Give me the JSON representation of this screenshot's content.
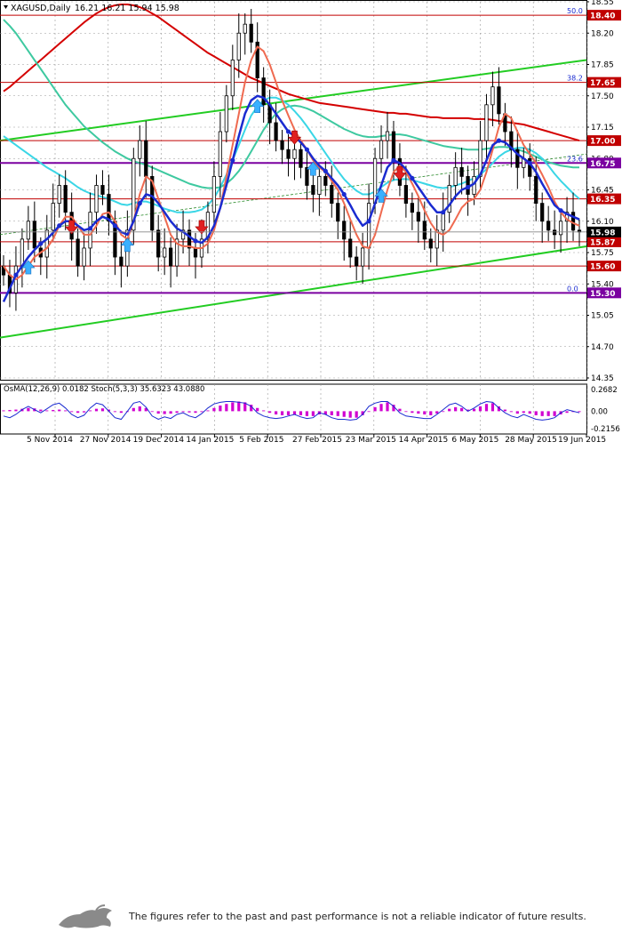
{
  "chart_data": {
    "type": "candlestick",
    "title": "XAGUSD,Daily",
    "ohlc_text": "16.21 16.21 15.94 15.98",
    "ylim": [
      14.35,
      18.55
    ],
    "price_ticks": [
      "18.55",
      "18.20",
      "17.85",
      "17.50",
      "17.15",
      "16.80",
      "16.45",
      "16.10",
      "15.75",
      "15.40",
      "15.05",
      "14.70",
      "14.35"
    ],
    "x_labels": [
      "5 Nov 2014",
      "27 Nov 2014",
      "19 Dec 2014",
      "14 Jan 2015",
      "5 Feb 2015",
      "27 Feb 2015",
      "23 Mar 2015",
      "14 Apr 2015",
      "6 May 2015",
      "28 May 2015",
      "19 Jun 2015"
    ],
    "levels": [
      {
        "value": 18.4,
        "label": "18.40",
        "color": "#c00000",
        "fib": "50.0"
      },
      {
        "value": 17.65,
        "label": "17.65",
        "color": "#c00000",
        "fib": "38.2"
      },
      {
        "value": 17.0,
        "label": "17.00",
        "color": "#c00000",
        "fib": ""
      },
      {
        "value": 16.75,
        "label": "16.75",
        "color": "#7a00a0",
        "fib": "23.6"
      },
      {
        "value": 16.35,
        "label": "16.35",
        "color": "#c00000",
        "fib": ""
      },
      {
        "value": 15.87,
        "label": "15.87",
        "color": "#c00000",
        "fib": ""
      },
      {
        "value": 15.6,
        "label": "15.60",
        "color": "#c00000",
        "fib": ""
      },
      {
        "value": 15.3,
        "label": "15.30",
        "color": "#7a00a0",
        "fib": "0.0"
      }
    ],
    "current": {
      "value": 15.98,
      "label": "15.98"
    },
    "closes": [
      15.5,
      15.3,
      15.6,
      15.9,
      16.1,
      15.8,
      15.7,
      16.0,
      16.3,
      16.5,
      16.2,
      15.9,
      15.6,
      15.8,
      16.2,
      16.5,
      16.4,
      16.1,
      15.7,
      15.6,
      16.0,
      16.8,
      17.0,
      16.6,
      16.0,
      15.7,
      15.8,
      15.6,
      15.9,
      16.0,
      15.8,
      15.7,
      15.9,
      16.2,
      16.6,
      17.1,
      17.5,
      17.9,
      18.2,
      18.3,
      18.1,
      17.7,
      17.4,
      17.2,
      17.0,
      16.9,
      16.8,
      16.9,
      16.7,
      16.5,
      16.4,
      16.6,
      16.5,
      16.3,
      16.1,
      15.9,
      15.7,
      15.6,
      15.8,
      16.3,
      16.8,
      17.0,
      17.1,
      16.8,
      16.5,
      16.3,
      16.2,
      16.1,
      15.9,
      15.8,
      16.0,
      16.2,
      16.5,
      16.7,
      16.6,
      16.4,
      16.6,
      17.0,
      17.4,
      17.6,
      17.3,
      17.1,
      16.9,
      16.7,
      16.8,
      16.6,
      16.3,
      16.1,
      16.0,
      15.95,
      16.1,
      16.2,
      16.0,
      15.98
    ],
    "ema_blue": [
      15.2,
      15.35,
      15.5,
      15.6,
      15.7,
      15.78,
      15.85,
      15.9,
      15.97,
      16.05,
      16.1,
      16.1,
      16.05,
      16.0,
      16.02,
      16.1,
      16.15,
      16.12,
      16.05,
      15.98,
      15.95,
      16.1,
      16.3,
      16.4,
      16.38,
      16.3,
      16.2,
      16.1,
      16.02,
      15.98,
      15.93,
      15.88,
      15.86,
      15.92,
      16.05,
      16.25,
      16.5,
      16.78,
      17.05,
      17.3,
      17.45,
      17.5,
      17.48,
      17.4,
      17.3,
      17.2,
      17.1,
      17.05,
      16.98,
      16.9,
      16.8,
      16.72,
      16.66,
      16.58,
      16.5,
      16.4,
      16.28,
      16.15,
      16.05,
      16.1,
      16.3,
      16.5,
      16.7,
      16.78,
      16.75,
      16.68,
      16.58,
      16.48,
      16.38,
      16.28,
      16.2,
      16.2,
      16.28,
      16.38,
      16.45,
      16.48,
      16.52,
      16.62,
      16.78,
      16.95,
      17.0,
      16.98,
      16.92,
      16.85,
      16.8,
      16.75,
      16.65,
      16.52,
      16.4,
      16.28,
      16.22,
      16.18,
      16.15,
      16.12
    ],
    "ma_cyan": [
      17.05,
      17.0,
      16.95,
      16.9,
      16.85,
      16.8,
      16.75,
      16.7,
      16.66,
      16.62,
      16.58,
      16.53,
      16.48,
      16.44,
      16.41,
      16.39,
      16.37,
      16.35,
      16.32,
      16.29,
      16.28,
      16.3,
      16.32,
      16.32,
      16.3,
      16.27,
      16.24,
      16.22,
      16.2,
      16.2,
      16.2,
      16.21,
      16.23,
      16.28,
      16.36,
      16.48,
      16.62,
      16.78,
      16.95,
      17.12,
      17.28,
      17.38,
      17.45,
      17.48,
      17.48,
      17.45,
      17.4,
      17.33,
      17.25,
      17.16,
      17.06,
      16.96,
      16.86,
      16.76,
      16.66,
      16.57,
      16.5,
      16.44,
      16.4,
      16.4,
      16.43,
      16.48,
      16.53,
      16.56,
      16.57,
      16.57,
      16.56,
      16.54,
      16.52,
      16.5,
      16.48,
      16.47,
      16.48,
      16.5,
      16.52,
      16.55,
      16.58,
      16.62,
      16.68,
      16.75,
      16.82,
      16.87,
      16.9,
      16.92,
      16.92,
      16.9,
      16.86,
      16.8,
      16.72,
      16.63,
      16.55,
      16.48,
      16.41,
      16.35
    ],
    "ma_teal": [
      18.35,
      18.28,
      18.2,
      18.1,
      18.0,
      17.9,
      17.8,
      17.7,
      17.6,
      17.5,
      17.4,
      17.32,
      17.24,
      17.16,
      17.1,
      17.04,
      16.98,
      16.93,
      16.88,
      16.84,
      16.8,
      16.77,
      16.75,
      16.73,
      16.7,
      16.67,
      16.64,
      16.61,
      16.58,
      16.55,
      16.52,
      16.5,
      16.48,
      16.47,
      16.47,
      16.48,
      16.52,
      16.58,
      16.66,
      16.76,
      16.88,
      17.0,
      17.12,
      17.22,
      17.3,
      17.35,
      17.38,
      17.39,
      17.38,
      17.36,
      17.33,
      17.29,
      17.25,
      17.21,
      17.17,
      17.13,
      17.1,
      17.07,
      17.05,
      17.04,
      17.04,
      17.05,
      17.06,
      17.07,
      17.07,
      17.06,
      17.04,
      17.02,
      17.0,
      16.98,
      16.96,
      16.94,
      16.93,
      16.92,
      16.91,
      16.9,
      16.9,
      16.9,
      16.91,
      16.92,
      16.93,
      16.93,
      16.92,
      16.9,
      16.88,
      16.85,
      16.82,
      16.79,
      16.76,
      16.74,
      16.72,
      16.71,
      16.7,
      16.7
    ],
    "ma_red": [
      17.55,
      17.6,
      17.66,
      17.72,
      17.78,
      17.84,
      17.9,
      17.96,
      18.02,
      18.08,
      18.14,
      18.2,
      18.26,
      18.32,
      18.37,
      18.42,
      18.46,
      18.49,
      18.51,
      18.52,
      18.52,
      18.51,
      18.49,
      18.46,
      18.42,
      18.38,
      18.33,
      18.28,
      18.23,
      18.18,
      18.13,
      18.08,
      18.03,
      17.98,
      17.94,
      17.9,
      17.86,
      17.82,
      17.78,
      17.74,
      17.7,
      17.67,
      17.64,
      17.61,
      17.58,
      17.55,
      17.52,
      17.5,
      17.48,
      17.46,
      17.44,
      17.42,
      17.41,
      17.4,
      17.39,
      17.38,
      17.37,
      17.36,
      17.35,
      17.34,
      17.33,
      17.32,
      17.31,
      17.31,
      17.3,
      17.3,
      17.29,
      17.28,
      17.27,
      17.26,
      17.26,
      17.25,
      17.25,
      17.25,
      17.25,
      17.25,
      17.24,
      17.24,
      17.24,
      17.23,
      17.22,
      17.21,
      17.2,
      17.19,
      17.18,
      17.16,
      17.14,
      17.12,
      17.1,
      17.08,
      17.06,
      17.04,
      17.02,
      17.0
    ],
    "ma_salmon": [
      15.6,
      15.5,
      15.45,
      15.5,
      15.6,
      15.7,
      15.75,
      15.8,
      15.9,
      16.05,
      16.15,
      16.15,
      16.05,
      15.95,
      15.95,
      16.05,
      16.18,
      16.2,
      16.1,
      15.95,
      15.9,
      16.1,
      16.4,
      16.6,
      16.55,
      16.35,
      16.15,
      15.95,
      15.85,
      15.82,
      15.82,
      15.8,
      15.8,
      15.85,
      16.0,
      16.25,
      16.6,
      16.95,
      17.3,
      17.65,
      17.9,
      18.05,
      18.0,
      17.85,
      17.65,
      17.45,
      17.28,
      17.12,
      17.0,
      16.9,
      16.78,
      16.7,
      16.65,
      16.55,
      16.45,
      16.3,
      16.12,
      15.95,
      15.82,
      15.8,
      15.95,
      16.2,
      16.45,
      16.65,
      16.72,
      16.65,
      16.52,
      16.38,
      16.22,
      16.08,
      15.98,
      15.95,
      16.0,
      16.12,
      16.25,
      16.32,
      16.35,
      16.45,
      16.65,
      16.9,
      17.15,
      17.3,
      17.25,
      17.1,
      16.95,
      16.85,
      16.75,
      16.62,
      16.48,
      16.32,
      16.2,
      16.12,
      16.08,
      16.05
    ],
    "osma": [
      0.01,
      0.015,
      0.02,
      0.03,
      0.04,
      0.035,
      0.02,
      0.01,
      0.015,
      0.02,
      0.01,
      -0.01,
      -0.02,
      -0.015,
      0.01,
      0.03,
      0.035,
      0.02,
      -0.01,
      -0.02,
      0.0,
      0.04,
      0.06,
      0.04,
      0.0,
      -0.03,
      -0.035,
      -0.03,
      -0.02,
      -0.01,
      -0.015,
      -0.02,
      -0.01,
      0.01,
      0.04,
      0.07,
      0.09,
      0.11,
      0.12,
      0.11,
      0.08,
      0.04,
      0.01,
      -0.02,
      -0.04,
      -0.05,
      -0.05,
      -0.04,
      -0.05,
      -0.06,
      -0.06,
      -0.04,
      -0.04,
      -0.05,
      -0.06,
      -0.07,
      -0.08,
      -0.08,
      -0.05,
      0.0,
      0.05,
      0.09,
      0.11,
      0.08,
      0.03,
      0.0,
      -0.02,
      -0.03,
      -0.04,
      -0.05,
      -0.03,
      0.0,
      0.03,
      0.05,
      0.04,
      0.02,
      0.03,
      0.06,
      0.09,
      0.1,
      0.06,
      0.02,
      -0.01,
      -0.03,
      -0.02,
      -0.03,
      -0.05,
      -0.06,
      -0.06,
      -0.06,
      -0.04,
      -0.02,
      -0.01,
      -0.01
    ],
    "stoch": [
      -0.06,
      -0.08,
      -0.04,
      0.02,
      0.06,
      0.02,
      -0.02,
      0.03,
      0.08,
      0.1,
      0.04,
      -0.04,
      -0.08,
      -0.05,
      0.04,
      0.1,
      0.08,
      0.0,
      -0.08,
      -0.1,
      0.0,
      0.1,
      0.12,
      0.05,
      -0.06,
      -0.1,
      -0.07,
      -0.09,
      -0.04,
      -0.02,
      -0.06,
      -0.08,
      -0.03,
      0.04,
      0.09,
      0.11,
      0.12,
      0.12,
      0.11,
      0.1,
      0.06,
      -0.02,
      -0.06,
      -0.08,
      -0.09,
      -0.08,
      -0.06,
      -0.04,
      -0.07,
      -0.09,
      -0.08,
      -0.02,
      -0.04,
      -0.08,
      -0.1,
      -0.1,
      -0.11,
      -0.1,
      -0.04,
      0.06,
      0.1,
      0.12,
      0.12,
      0.06,
      -0.02,
      -0.06,
      -0.07,
      -0.08,
      -0.09,
      -0.09,
      -0.04,
      0.02,
      0.08,
      0.1,
      0.06,
      0.0,
      0.04,
      0.09,
      0.12,
      0.11,
      0.04,
      -0.02,
      -0.06,
      -0.08,
      -0.04,
      -0.07,
      -0.1,
      -0.11,
      -0.1,
      -0.08,
      -0.02,
      0.02,
      0.0,
      -0.02
    ],
    "ind_label": "OsMA(12,26,9) 0.0182  Stoch(5,3,3) 35.6323 43.0880",
    "ind_ticks": [
      "0.2682",
      "0.00",
      "-0.2156"
    ],
    "ind_ylim": [
      -0.2156,
      0.2682
    ],
    "up_arrows": [
      4,
      20,
      41,
      50,
      61
    ],
    "down_arrows": [
      11,
      32,
      47,
      64
    ],
    "blue_dots": [
      2,
      6,
      9,
      14,
      18,
      22,
      31,
      37,
      46,
      49,
      52,
      55,
      59,
      63,
      66,
      71,
      75,
      80,
      85,
      90
    ],
    "channel": {
      "upper": [
        17.0,
        17.9
      ],
      "lower": [
        14.8,
        15.82
      ]
    }
  },
  "footer": {
    "disclaimer": "The figures refer to the past and past performance is not a reliable indicator of future results."
  },
  "colors": {
    "bull": "#000000",
    "bear": "#000000",
    "ema_blue": "#1a2bd0",
    "ma_cyan": "#3ad6e6",
    "ma_teal": "#3ec9a0",
    "ma_red": "#d40000",
    "ma_salmon": "#ef6a50",
    "channel": "#22cc22",
    "hist": "#d000d0",
    "stoch": "#1a2bd0"
  }
}
